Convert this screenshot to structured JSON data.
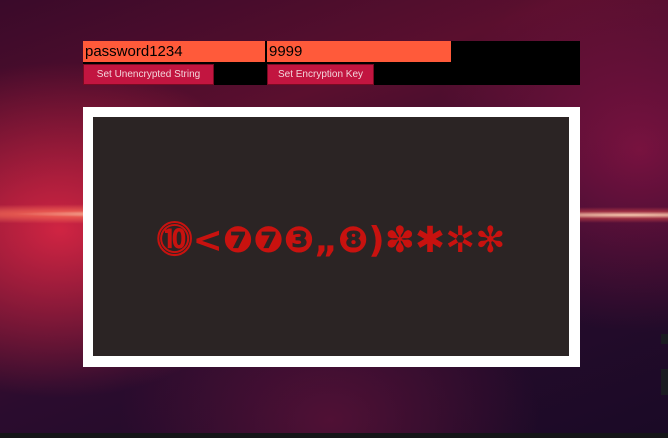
{
  "inputs": {
    "unencrypted_string": "password1234",
    "encryption_key": "9999"
  },
  "buttons": {
    "set_unencrypted_label": "Set Unencrypted String",
    "set_key_label": "Set Encryption Key"
  },
  "output": {
    "encrypted_text": "⓾<❼❼❸„❽)✽✱✲✻"
  },
  "colors": {
    "input_background": "#ff5a3a",
    "button_background": "#c21540",
    "output_background": "#2b2424",
    "output_text": "#c8120f"
  }
}
